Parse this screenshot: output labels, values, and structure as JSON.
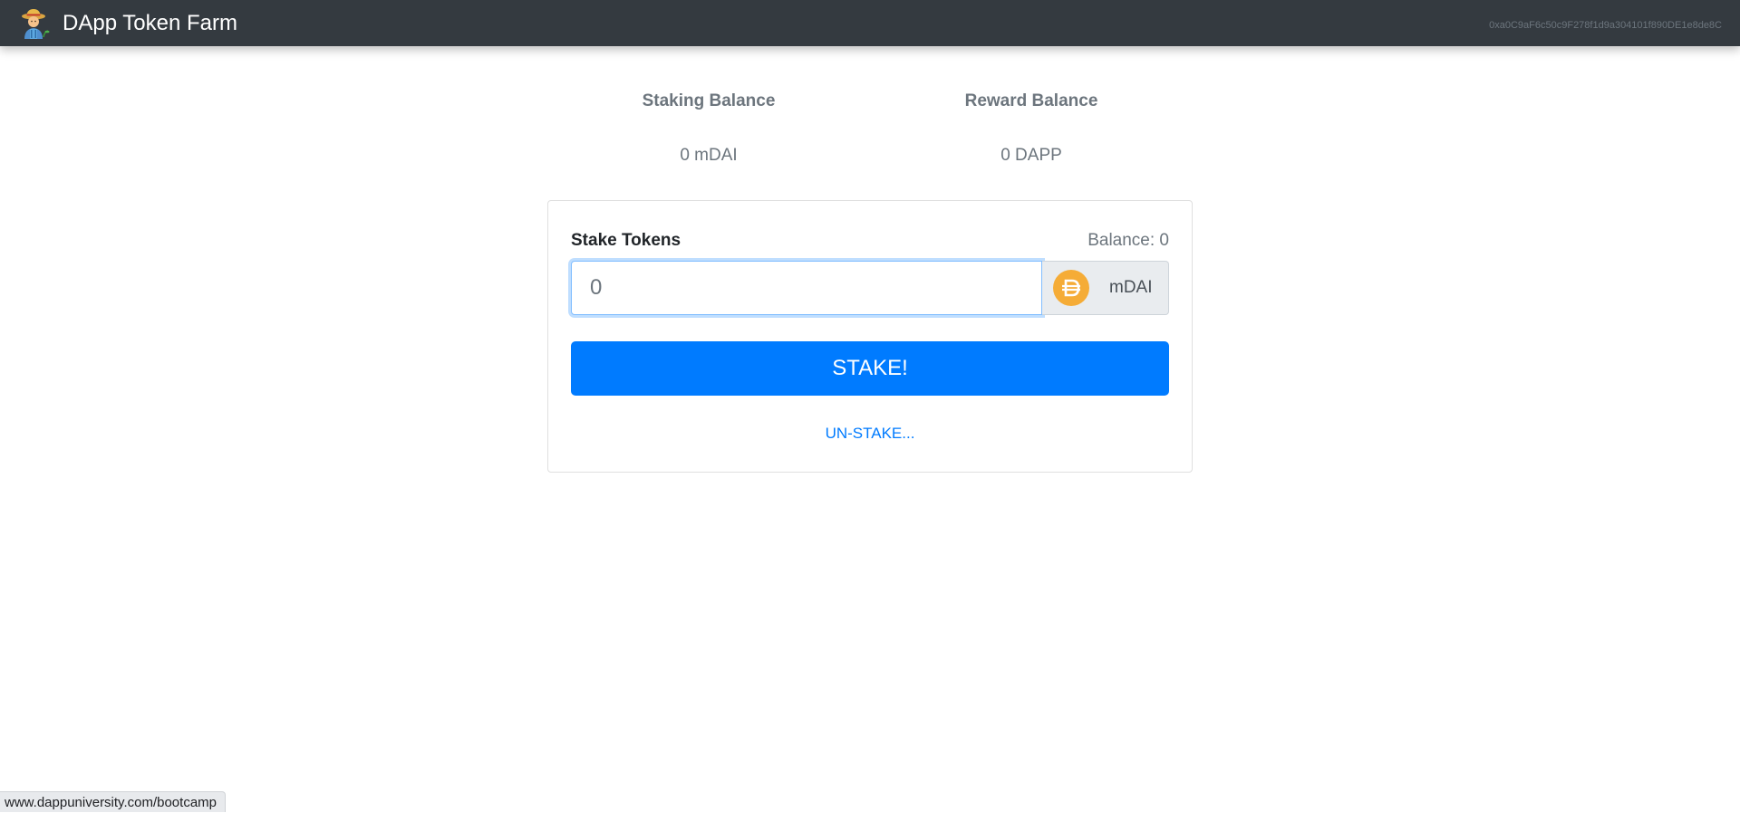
{
  "navbar": {
    "brand_text": "DApp Token Farm",
    "logo_icon": "farmer-icon",
    "account": "0xa0C9aF6c50c9F278f1d9a304101f890DE1e8de8C"
  },
  "balances": {
    "staking_label": "Staking Balance",
    "staking_value": "0 mDAI",
    "reward_label": "Reward Balance",
    "reward_value": "0 DAPP"
  },
  "stake_form": {
    "title": "Stake Tokens",
    "balance_text": "Balance: 0",
    "input_placeholder": "0",
    "input_value": "",
    "token_icon": "dai-icon",
    "token_name": "mDAI",
    "stake_button": "STAKE!",
    "unstake_button": "UN-STAKE..."
  },
  "status_bar": {
    "url": "www.dappuniversity.com/bootcamp"
  },
  "colors": {
    "navbar": "#343a40",
    "primary": "#007bff",
    "muted": "#6c757d",
    "dai": "#f5ac37"
  }
}
